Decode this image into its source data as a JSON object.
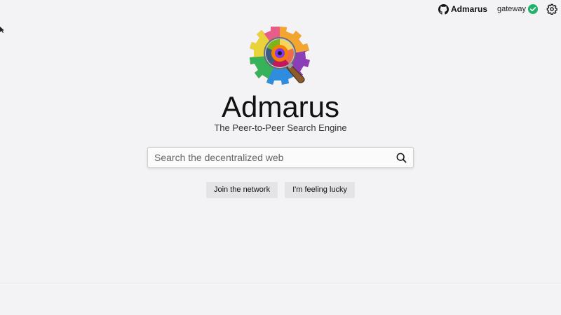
{
  "header": {
    "github_label": "Admarus",
    "gateway_label": "gateway",
    "gateway_status_color": "#21b36b"
  },
  "main": {
    "title": "Admarus",
    "subtitle": "The Peer-to-Peer Search Engine"
  },
  "search": {
    "placeholder": "Search the decentralized web",
    "value": ""
  },
  "actions": {
    "join_label": "Join the network",
    "lucky_label": "I'm feeling lucky"
  },
  "icons": {
    "github": "github-icon",
    "check": "check-circle-icon",
    "settings": "gear-icon",
    "search": "search-icon",
    "logo": "magnifier-logo"
  }
}
